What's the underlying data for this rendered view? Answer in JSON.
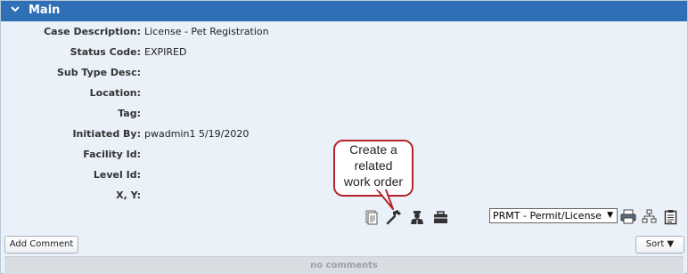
{
  "section": {
    "title": "Main",
    "collapse_icon": "chevron-down-icon"
  },
  "fields": [
    {
      "label": "Case Description:",
      "value": "License - Pet Registration"
    },
    {
      "label": "Status Code:",
      "value": "EXPIRED"
    },
    {
      "label": "Sub Type Desc:",
      "value": ""
    },
    {
      "label": "Location:",
      "value": ""
    },
    {
      "label": "Tag:",
      "value": ""
    },
    {
      "label": "Initiated By:",
      "value": "pwadmin1 5/19/2020"
    },
    {
      "label": "Facility Id:",
      "value": ""
    },
    {
      "label": "Level Id:",
      "value": ""
    },
    {
      "label": "X, Y:",
      "value": ""
    }
  ],
  "callout": {
    "line1": "Create a",
    "line2": "related",
    "line3": "work order",
    "border_color": "#b2242a"
  },
  "action_icons": [
    "document-icon",
    "hammer-icon",
    "inspector-icon",
    "briefcase-icon"
  ],
  "report_select": {
    "selected": "PRMT - Permit/License",
    "arrow": "▼"
  },
  "right_icons": [
    "printer-icon",
    "hierarchy-icon",
    "clipboard-icon"
  ],
  "add_comment_button": "Add Comment",
  "sort_button": {
    "label": "Sort",
    "arrow": "▼"
  },
  "comments": {
    "empty_text": "no comments"
  },
  "colors": {
    "header": "#2f6fb5",
    "panel_bg": "#eaf1f9"
  }
}
